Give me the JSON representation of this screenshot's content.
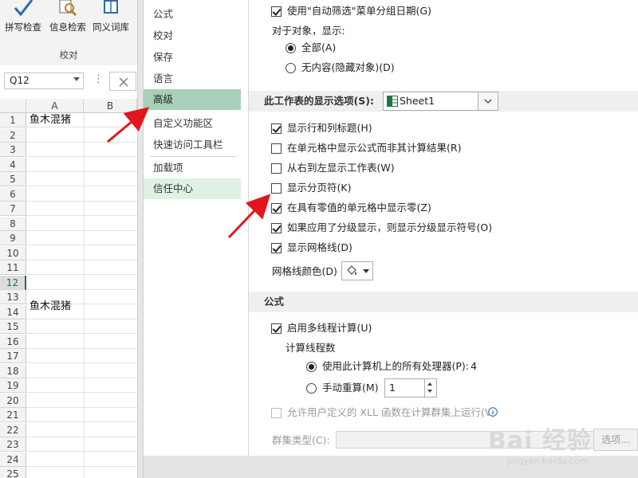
{
  "ribbon": {
    "buttons": [
      "拼写检查",
      "信息检索",
      "同义词库"
    ],
    "group_label": "校对"
  },
  "formula_bar": {
    "name_box": "Q12"
  },
  "sheet": {
    "columns": [
      "A",
      "B"
    ],
    "rows": [
      "1",
      "2",
      "3",
      "4",
      "5",
      "6",
      "7",
      "8",
      "9",
      "10",
      "11",
      "12",
      "13",
      "14",
      "15",
      "16",
      "17",
      "18",
      "19",
      "20",
      "21",
      "22",
      "23",
      "24",
      "25"
    ],
    "selected_row": "12",
    "cells": {
      "a1": "鱼木混猪",
      "a14": "鱼木混猪"
    }
  },
  "nav": {
    "items": [
      "公式",
      "校对",
      "保存",
      "语言",
      "高级",
      "自定义功能区",
      "快速访问工具栏",
      "加载项",
      "信任中心"
    ],
    "active": "高级"
  },
  "options": {
    "group_dates": "使用\"自动筛选\"菜单分组日期(G)",
    "objects_label": "对于对象，显示:",
    "objects_all": "全部(A)",
    "objects_none": "无内容(隐藏对象)(D)",
    "sheet_section": "此工作表的显示选项(S):",
    "sheet_value": "Sheet1",
    "show_headers": "显示行和列标题(H)",
    "show_formulas": "在单元格中显示公式而非其计算结果(R)",
    "right_to_left": "从右到左显示工作表(W)",
    "show_page_breaks": "显示分页符(K)",
    "show_zero": "在具有零值的单元格中显示零(Z)",
    "show_outline": "如果应用了分级显示，则显示分级显示符号(O)",
    "show_gridlines": "显示网格线(D)",
    "gridline_color": "网格线颜色(D)",
    "formula_section": "公式",
    "multithread": "启用多线程计算(U)",
    "thread_count_label": "计算线程数",
    "use_all_processors": "使用此计算机上的所有处理器(P):",
    "processor_count": "4",
    "manual": "手动重算(M)",
    "manual_value": "1",
    "xll_cluster": "允许用户定义的 XLL 函数在计算群集上运行(V)",
    "cluster_type": "群集类型(C):",
    "options_button": "选项..."
  },
  "watermark": {
    "logo": "Bai 经验",
    "url": "jingyan.baidu.com"
  },
  "colors": {
    "nav_active": "#a6d0b7",
    "nav_hover": "#dff0e5",
    "arrow": "#e3161e",
    "excel_green": "#217346"
  },
  "icons": [
    "spell-check-icon",
    "research-icon",
    "thesaurus-icon",
    "sheet-icon",
    "paint-bucket-icon",
    "info-icon"
  ]
}
